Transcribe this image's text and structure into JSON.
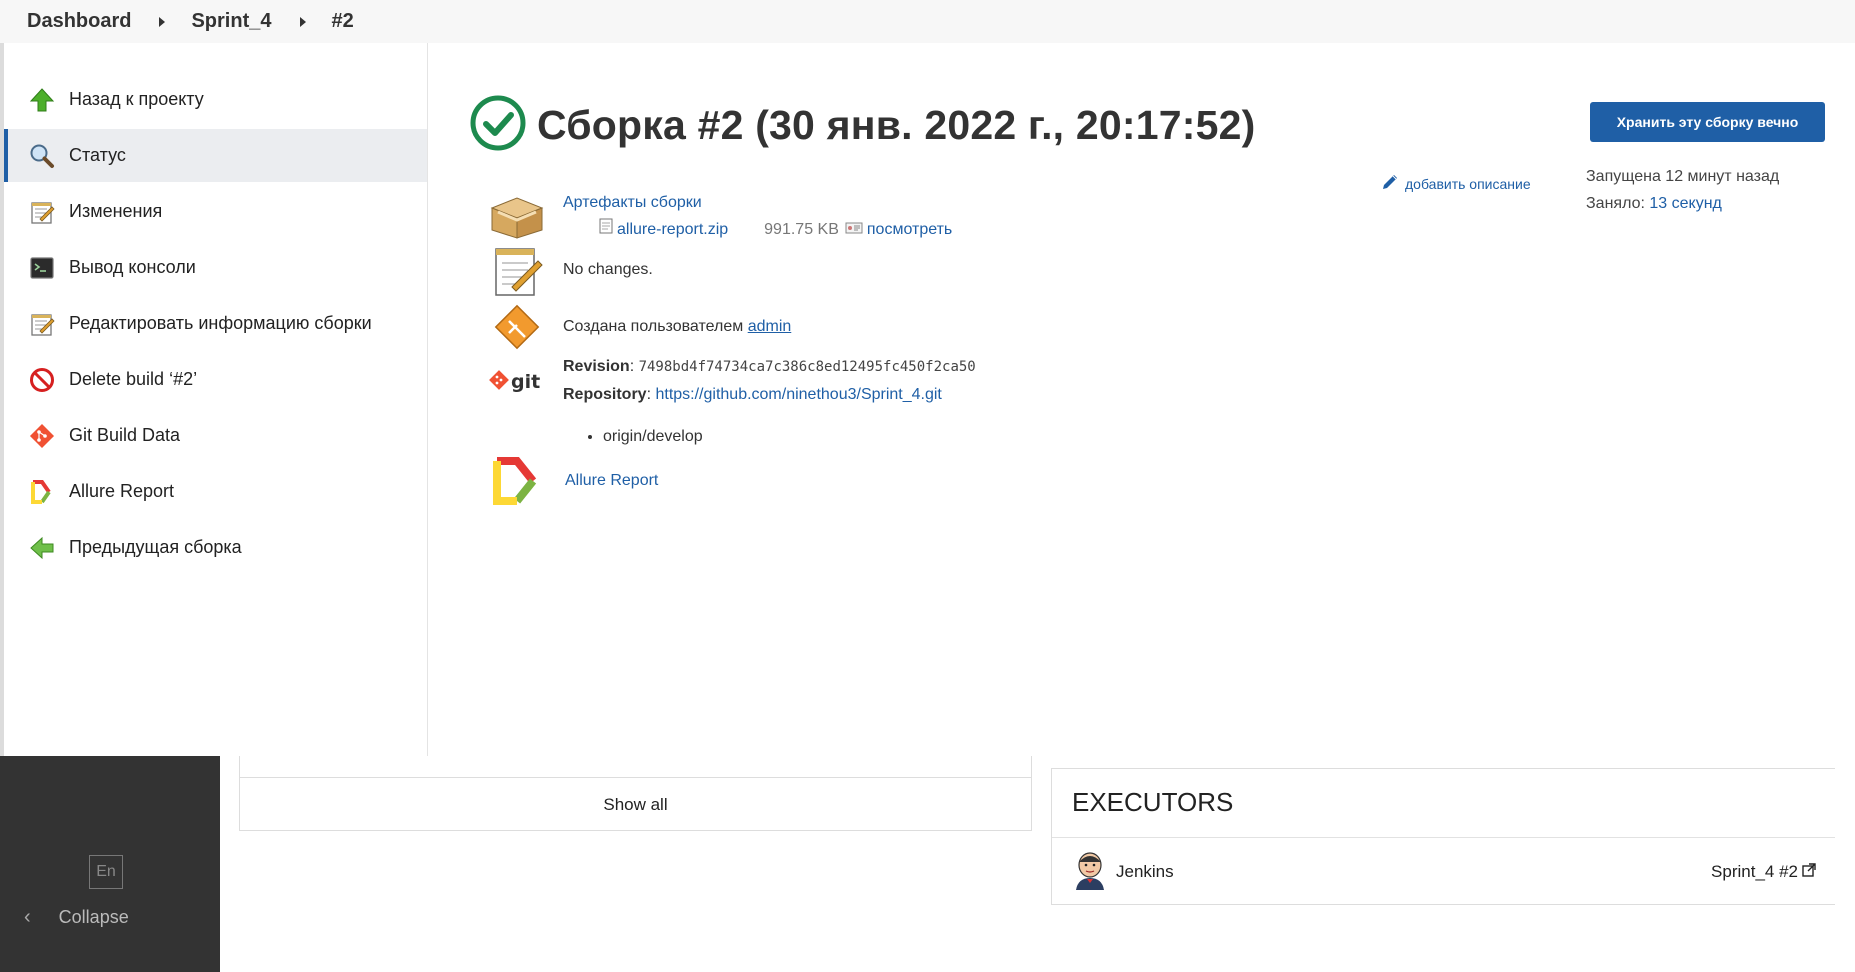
{
  "breadcrumb": {
    "items": [
      "Dashboard",
      "Sprint_4",
      "#2"
    ]
  },
  "sidebar": {
    "items": [
      {
        "label": "Назад к проекту",
        "icon": "up-arrow-icon"
      },
      {
        "label": "Статус",
        "icon": "search-icon",
        "active": true
      },
      {
        "label": "Изменения",
        "icon": "notepad-icon"
      },
      {
        "label": "Вывод консоли",
        "icon": "terminal-icon"
      },
      {
        "label": "Редактировать информацию сборки",
        "icon": "notepad-icon"
      },
      {
        "label": "Delete build ‘#2’",
        "icon": "no-entry-icon"
      },
      {
        "label": "Git Build Data",
        "icon": "git-icon"
      },
      {
        "label": "Allure Report",
        "icon": "allure-icon"
      },
      {
        "label": "Предыдущая сборка",
        "icon": "left-arrow-icon"
      }
    ]
  },
  "build": {
    "title": "Сборка #2 (30 янв. 2022 г., 20:17:52)",
    "status_icon": "success-check-icon",
    "keep_button": "Хранить эту сборку вечно",
    "add_description": "добавить описание",
    "started": "Запущена 12 минут назад",
    "took_prefix": "Заняло:",
    "took_value": "13 секунд"
  },
  "artifacts": {
    "heading": "Артефакты сборки",
    "file_name": "allure-report.zip",
    "file_size": "991.75 KB",
    "view_label": "посмотреть"
  },
  "changes": {
    "text": "No changes."
  },
  "cause": {
    "prefix": "Создана пользователем",
    "user": "admin"
  },
  "git": {
    "revision_label": "Revision",
    "revision": "7498bd4f74734ca7c386c8ed12495fc450f2ca50",
    "repository_label": "Repository",
    "repository": "https://github.com/ninethou3/Sprint_4.git",
    "branches": [
      "origin/develop"
    ]
  },
  "allure": {
    "label": "Allure Report"
  },
  "bottom": {
    "lang": "En",
    "collapse": "Collapse",
    "show_all": "Show all",
    "executors_title": "EXECUTORS",
    "executor_name": "Jenkins",
    "executor_job": "Sprint_4 #2"
  },
  "colors": {
    "accent": "#1f5fa6",
    "success": "#1d8a4e",
    "dark_panel": "#333333"
  }
}
